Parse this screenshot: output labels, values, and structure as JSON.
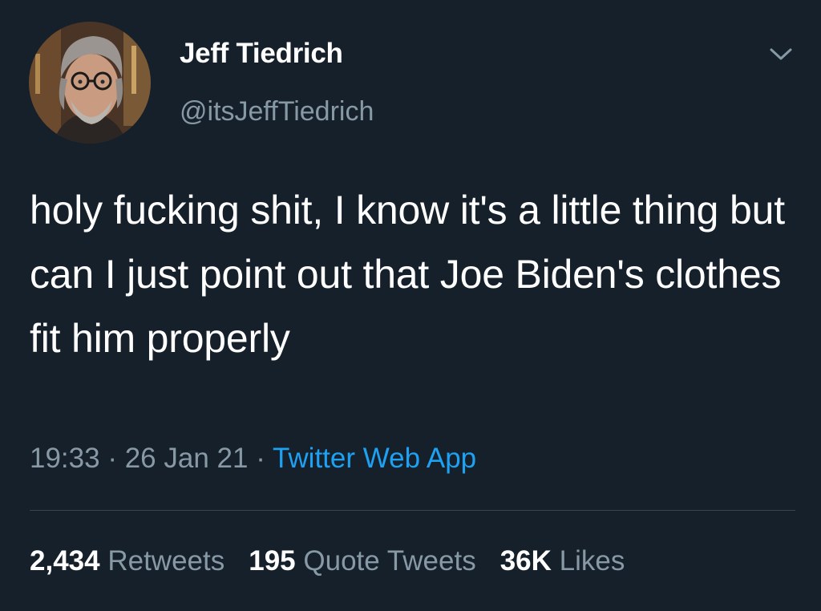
{
  "author": {
    "display_name": "Jeff Tiedrich",
    "handle": "@itsJeffTiedrich",
    "avatar_icon": "user-avatar-photo"
  },
  "tweet": {
    "text": "holy fucking shit, I know it's a little thing but can I just point out that Joe Biden's clothes fit him properly",
    "time": "19:33",
    "date": "26 Jan 21",
    "separator": "·",
    "source": "Twitter Web App"
  },
  "stats": {
    "retweets_count": "2,434",
    "retweets_label": "Retweets",
    "quotes_count": "195",
    "quotes_label": "Quote Tweets",
    "likes_count": "36K",
    "likes_label": "Likes"
  },
  "colors": {
    "background": "#15202b",
    "text_primary": "#ffffff",
    "text_secondary": "#8899a6",
    "link": "#1da1f2",
    "divider": "#38444d"
  },
  "icons": {
    "menu": "chevron-down-icon"
  }
}
